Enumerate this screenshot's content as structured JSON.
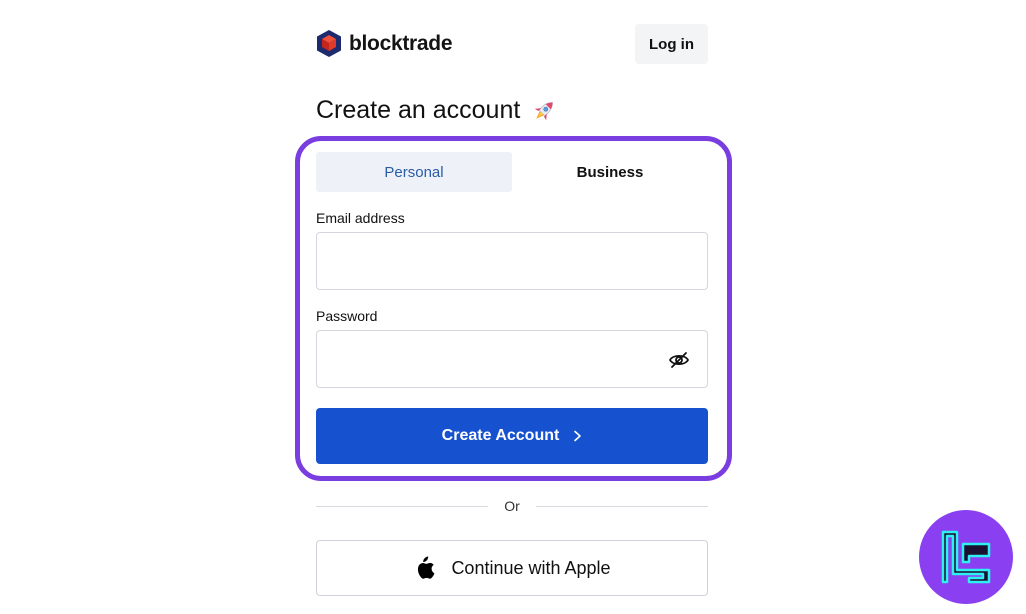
{
  "header": {
    "brand": "blocktrade",
    "login_label": "Log in"
  },
  "page_title": "Create an account",
  "title_icon": "rocket-emoji",
  "tabs": [
    {
      "label": "Personal",
      "active": true
    },
    {
      "label": "Business",
      "active": false
    }
  ],
  "form": {
    "email_label": "Email address",
    "email_value": "",
    "password_label": "Password",
    "password_value": "",
    "password_toggle_icon": "eye-slash-icon",
    "submit_label": "Create Account"
  },
  "divider_text": "Or",
  "apple_label": "Continue with Apple",
  "colors": {
    "primary": "#1651cf",
    "highlight": "#7a3ee0",
    "active_tab_bg": "#eef2f8",
    "active_tab_text": "#2a5ca8"
  }
}
